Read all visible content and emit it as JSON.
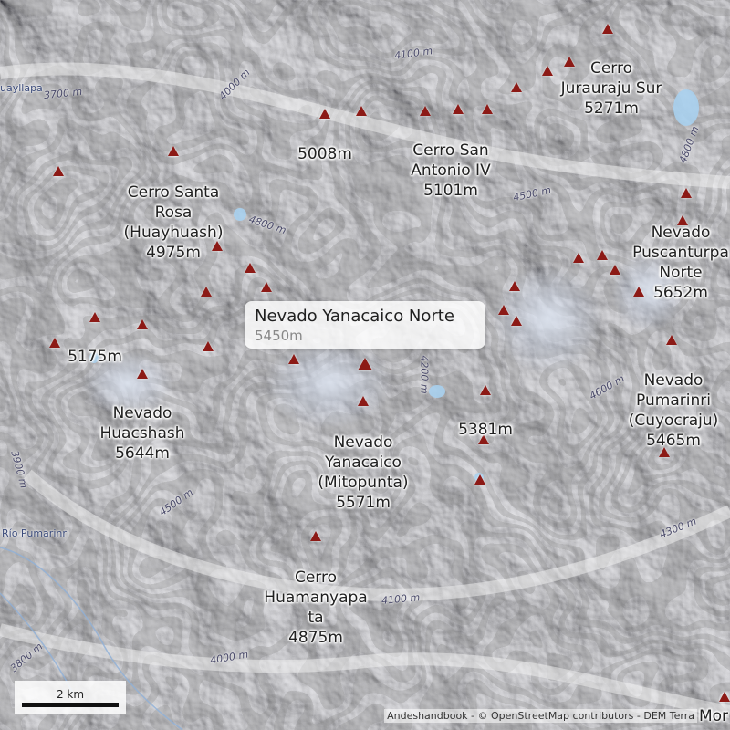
{
  "map": {
    "colors": {
      "peak": "#8c1a16",
      "lake": "#a8d0ee",
      "contour_label": "#4a4a6a"
    }
  },
  "popup": {
    "name": "Nevado Yanacaico Norte",
    "elevation": "5450m"
  },
  "peaks_labeled": [
    {
      "id": "cerro-jurauraju-sur",
      "name": "Cerro\nJurauraju Sur",
      "elevation": "5271m"
    },
    {
      "id": "5008",
      "name": "",
      "elevation": "5008m"
    },
    {
      "id": "cerro-san-antonio-iv",
      "name": "Cerro San\nAntonio IV",
      "elevation": "5101m"
    },
    {
      "id": "cerro-santa-rosa",
      "name": "Cerro Santa\nRosa\n(Huayhuash)",
      "elevation": "4975m"
    },
    {
      "id": "nevado-puscanturpa-norte",
      "name": "Nevado\nPuscanturpa\nNorte",
      "elevation": "5652m"
    },
    {
      "id": "5175",
      "name": "",
      "elevation": "5175m"
    },
    {
      "id": "nevado-pumarinri",
      "name": "Nevado\nPumarinri\n(Cuyocraju)",
      "elevation": "5465m"
    },
    {
      "id": "5381",
      "name": "",
      "elevation": "5381m"
    },
    {
      "id": "nevado-huacshash",
      "name": "Nevado\nHuacshash",
      "elevation": "5644m"
    },
    {
      "id": "nevado-yanacaico",
      "name": "Nevado\nYanacaico\n(Mitopunta)",
      "elevation": "5571m"
    },
    {
      "id": "cerro-huamanyapata",
      "name": "Cerro\nHuamanyapa\nta",
      "elevation": "4875m"
    }
  ],
  "contour_labels": [
    "4100 m",
    "4000 m",
    "3700 m",
    "4800 m",
    "4500 m",
    "4800 m",
    "4600 m",
    "4200 m",
    "3900 m",
    "4500 m",
    "4300 m",
    "4100 m",
    "4000 m",
    "3800 m"
  ],
  "place_labels": {
    "top_left": "uayllapa",
    "river": "Río Pumarinri",
    "bottom_right": "Mor"
  },
  "scalebar": {
    "label": "2 km"
  },
  "attribution": "Andeshandbook - © OpenStreetMap contributors - DEM Terra"
}
